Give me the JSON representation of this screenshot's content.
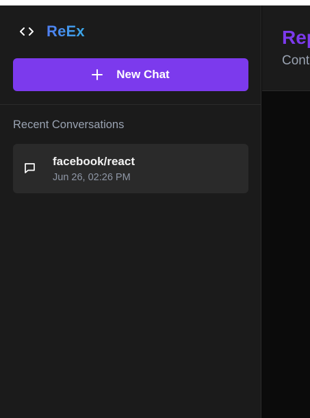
{
  "app": {
    "name": "ReEx",
    "logo_icon": "code-brackets-icon"
  },
  "sidebar": {
    "new_chat_label": "New Chat",
    "new_chat_icon": "plus-icon",
    "recent_title": "Recent Conversations",
    "conversations": [
      {
        "title": "facebook/react",
        "timestamp": "Jun 26, 02:26 PM",
        "icon": "chat-bubble-icon"
      }
    ]
  },
  "main": {
    "title": "Rep",
    "subtitle": "Cont"
  },
  "colors": {
    "accent": "#7c3aed",
    "brand_gradient_start": "#4f7df0",
    "brand_gradient_end": "#3aa7e6",
    "sidebar_bg": "#1b1b1b",
    "main_bg": "#0b0b0b",
    "card_bg": "#2a2a2a"
  }
}
